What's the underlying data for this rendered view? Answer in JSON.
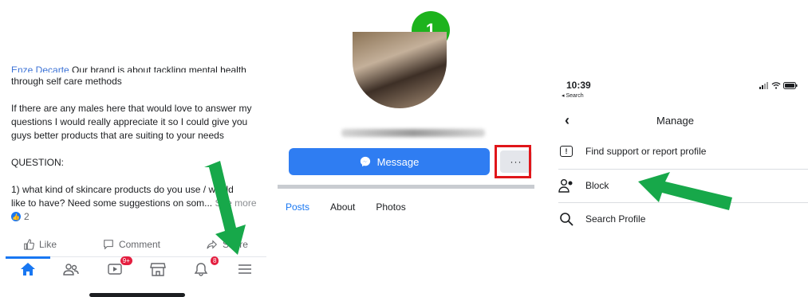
{
  "step": {
    "number": "1",
    "color": "#1db31d"
  },
  "post_panel": {
    "author": "Enze Decarte",
    "first_line_rest": " Our brand is about tackling mental health",
    "lines": [
      "through self care methods",
      "",
      "If there are any males here that would love to answer my",
      "questions I would really appreciate it so I could give you",
      "guys better products that are suiting  to your needs",
      "",
      "QUESTION:",
      "",
      "1) what kind of skincare products do you use / would",
      "like to have? Need some suggestions on som..."
    ],
    "see_more": " See more",
    "reaction_count": "2",
    "actions": {
      "like": "Like",
      "comment": "Comment",
      "share": "Share"
    },
    "tabs": [
      {
        "name": "home-icon",
        "active": true
      },
      {
        "name": "friends-icon"
      },
      {
        "name": "watch-icon",
        "badge": "9+"
      },
      {
        "name": "marketplace-icon"
      },
      {
        "name": "notifications-icon",
        "badge": "8"
      },
      {
        "name": "menu-icon"
      }
    ]
  },
  "profile_panel": {
    "message_label": "Message",
    "more_label": "···",
    "tabs": [
      "Posts",
      "About",
      "Photos"
    ],
    "highlight_color": "#e0161a",
    "accent": "#2f7df2"
  },
  "manage_panel": {
    "time": "10:39",
    "back_label": "◂ Search",
    "title": "Manage",
    "items": [
      {
        "label": "Find support or report profile",
        "icon": "report-icon"
      },
      {
        "label": "Block",
        "icon": "block-person-icon"
      },
      {
        "label": "Search Profile",
        "icon": "search-icon"
      }
    ]
  },
  "arrow_color": "#17a84a"
}
